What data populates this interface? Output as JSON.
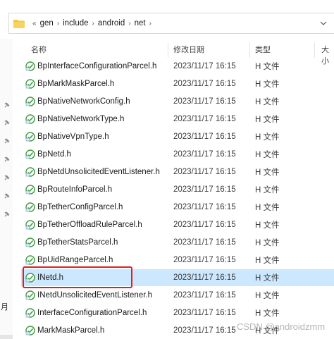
{
  "breadcrumb": {
    "overflow": "«",
    "items": [
      "gen",
      "include",
      "android",
      "net"
    ]
  },
  "header": {
    "name": "名称",
    "date": "修改日期",
    "type": "类型",
    "size": "大小"
  },
  "rows": [
    {
      "name": "BpInterfaceConfigurationParcel.h",
      "date": "2023/11/17 16:15",
      "type": "H 文件"
    },
    {
      "name": "BpMarkMaskParcel.h",
      "date": "2023/11/17 16:15",
      "type": "H 文件"
    },
    {
      "name": "BpNativeNetworkConfig.h",
      "date": "2023/11/17 16:15",
      "type": "H 文件"
    },
    {
      "name": "BpNativeNetworkType.h",
      "date": "2023/11/17 16:15",
      "type": "H 文件"
    },
    {
      "name": "BpNativeVpnType.h",
      "date": "2023/11/17 16:15",
      "type": "H 文件"
    },
    {
      "name": "BpNetd.h",
      "date": "2023/11/17 16:15",
      "type": "H 文件"
    },
    {
      "name": "BpNetdUnsolicitedEventListener.h",
      "date": "2023/11/17 16:15",
      "type": "H 文件"
    },
    {
      "name": "BpRouteInfoParcel.h",
      "date": "2023/11/17 16:15",
      "type": "H 文件"
    },
    {
      "name": "BpTetherConfigParcel.h",
      "date": "2023/11/17 16:15",
      "type": "H 文件"
    },
    {
      "name": "BpTetherOffloadRuleParcel.h",
      "date": "2023/11/17 16:15",
      "type": "H 文件"
    },
    {
      "name": "BpTetherStatsParcel.h",
      "date": "2023/11/17 16:15",
      "type": "H 文件"
    },
    {
      "name": "BpUidRangeParcel.h",
      "date": "2023/11/17 16:15",
      "type": "H 文件"
    },
    {
      "name": "INetd.h",
      "date": "2023/11/17 16:15",
      "type": "H 文件"
    },
    {
      "name": "INetdUnsolicitedEventListener.h",
      "date": "2023/11/17 16:15",
      "type": "H 文件"
    },
    {
      "name": "InterfaceConfigurationParcel.h",
      "date": "2023/11/17 16:15",
      "type": "H 文件"
    },
    {
      "name": "MarkMaskParcel.h",
      "date": "2023/11/17 16:15",
      "type": "H 文件"
    }
  ],
  "selected_index": 12,
  "nav": {
    "partial_label": "月"
  },
  "watermark": "CSDN @androidzmm",
  "colors": {
    "selection": "#cce8ff",
    "highlight_border": "#e02020",
    "folder": "#f4c542",
    "file_icon_accent": "#3c9a3c"
  },
  "icons": {
    "folder": "folder-icon",
    "file": "h-file-icon",
    "pin": "pin-icon",
    "refresh": "refresh-icon"
  }
}
